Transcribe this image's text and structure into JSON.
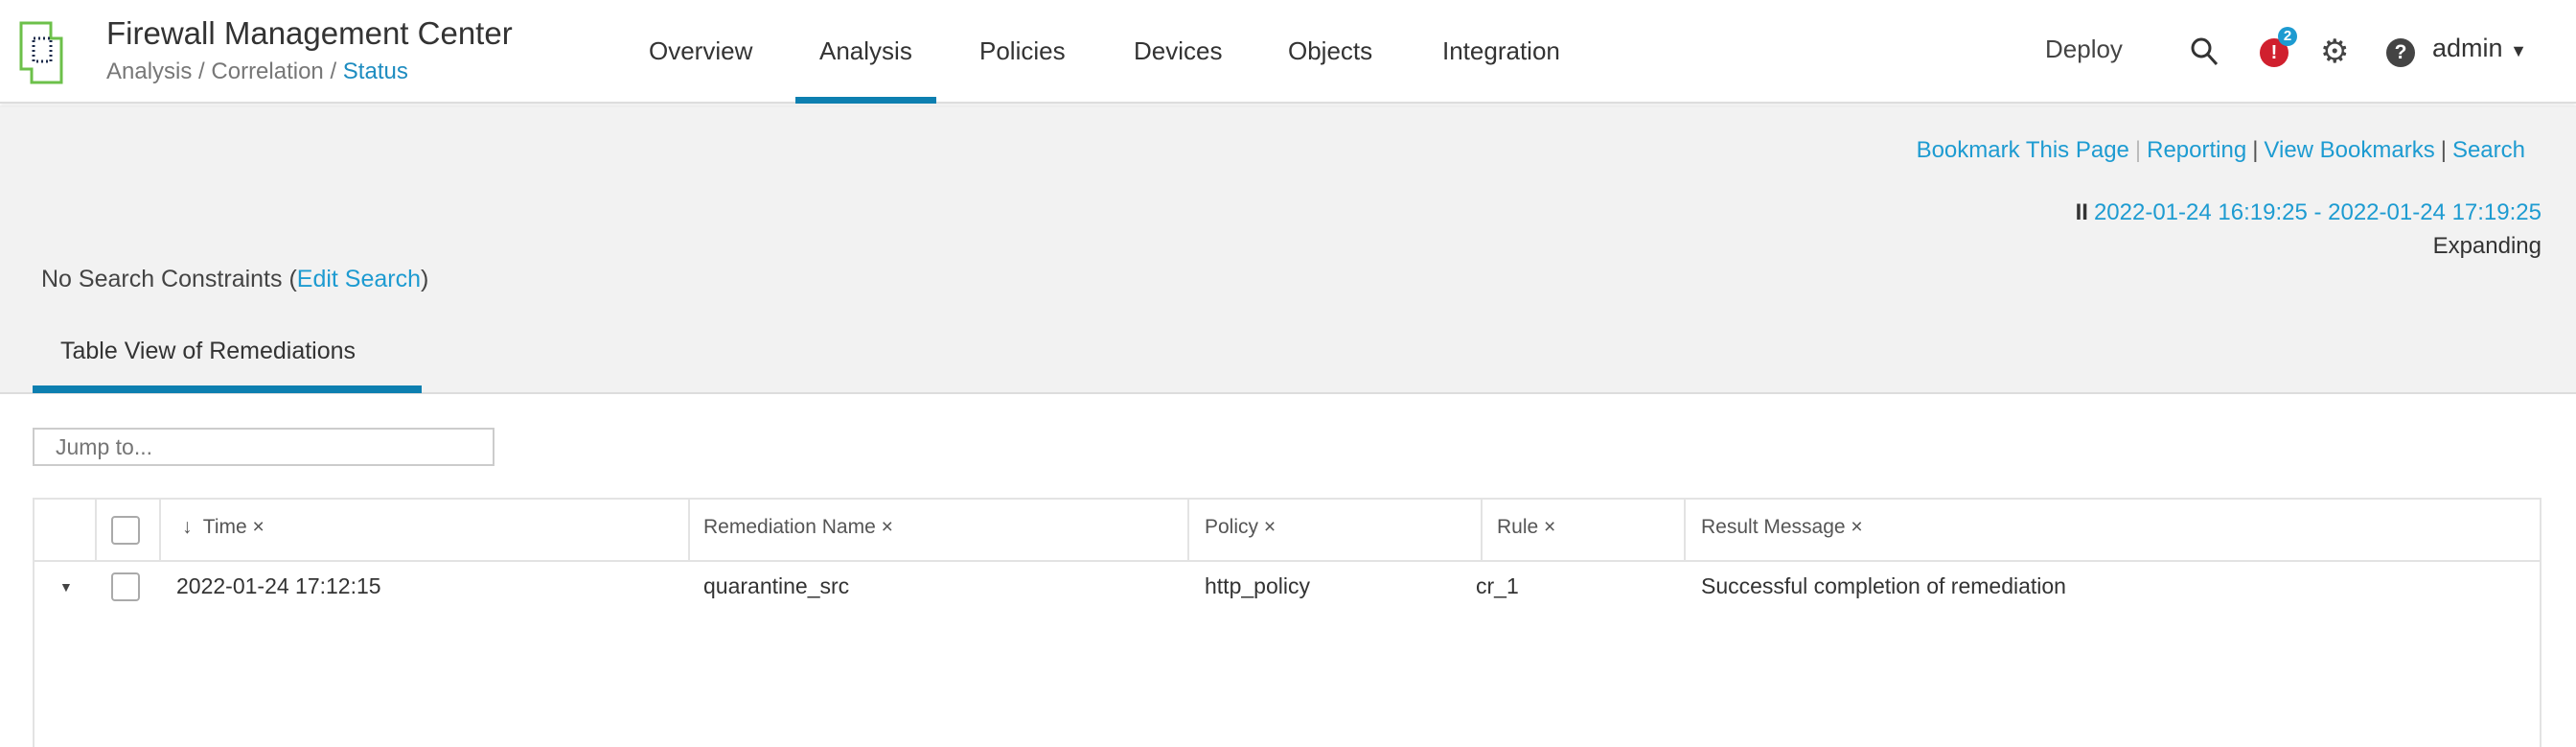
{
  "header": {
    "title": "Firewall Management Center",
    "breadcrumb": [
      "Analysis",
      "Correlation",
      "Status"
    ],
    "breadcrumb_sep": "/",
    "nav": [
      "Overview",
      "Analysis",
      "Policies",
      "Devices",
      "Objects",
      "Integration"
    ],
    "active_nav": "Analysis",
    "deploy_label": "Deploy",
    "notification_count": "2",
    "user": "admin"
  },
  "toolbar": {
    "links": [
      "Bookmark This Page",
      "Reporting",
      "View Bookmarks",
      "Search"
    ],
    "pause_glyph": "II",
    "time_range": "2022-01-24 16:19:25 - 2022-01-24 17:19:25",
    "time_mode": "Expanding"
  },
  "search": {
    "prefix": "No Search Constraints (",
    "edit_link": "Edit Search",
    "suffix": ")"
  },
  "tabs": [
    {
      "label": "Table View of Remediations",
      "active": true
    }
  ],
  "jump": {
    "placeholder": "Jump to..."
  },
  "table": {
    "columns": [
      "Time ×",
      "Remediation Name ×",
      "Policy ×",
      "Rule ×",
      "Result Message ×"
    ],
    "sort_glyph": "↓",
    "rows": [
      {
        "time": "2022-01-24 17:12:15",
        "name": "quarantine_src",
        "policy": "http_policy",
        "rule": "cr_1",
        "message": "Successful completion of remediation"
      }
    ]
  },
  "colors": {
    "accent": "#1d9bd1",
    "tab_underline": "#0d7fb0",
    "alert": "#d0202e",
    "logo": "#6cc04a"
  }
}
